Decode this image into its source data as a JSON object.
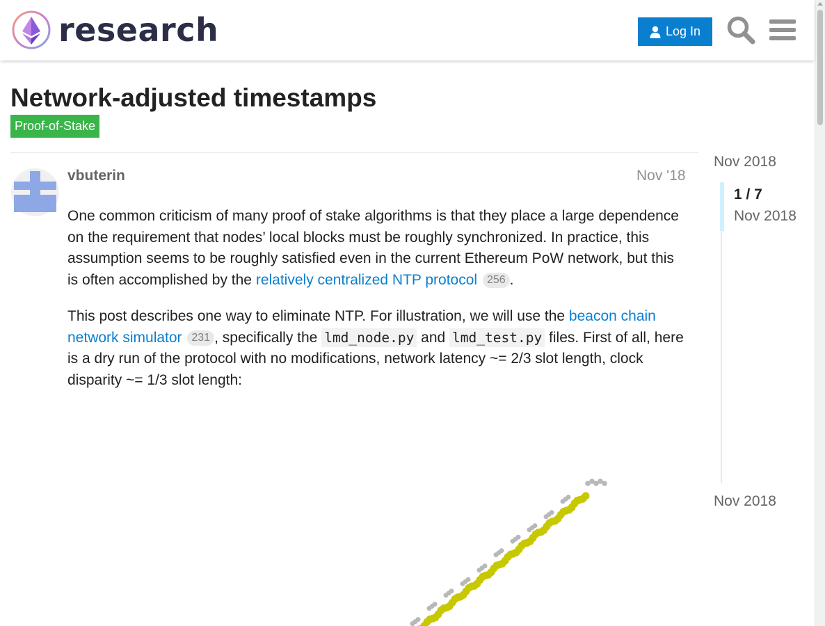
{
  "site": {
    "brand": "research"
  },
  "header": {
    "login_label": "Log In"
  },
  "topic": {
    "title": "Network-adjusted timestamps",
    "category": "Proof-of-Stake",
    "category_color": "#3ab54a"
  },
  "post": {
    "username": "vbuterin",
    "date": "Nov '18",
    "p1_text": "One common criticism of many proof of stake algorithms is that they place a large dependence on the requirement that nodes’ local blocks must be roughly synchronized. In practice, this assumption seems to be roughly satisfied even in the current Ethereum PoW network, but this is often accomplished by the ",
    "p1_link": "relatively centralized NTP protocol",
    "p1_link_count": "256",
    "p1_end": ".",
    "p2_text_a": "This post describes one way to eliminate NTP. For illustration, we will use the ",
    "p2_link": "beacon chain network simulator",
    "p2_link_count": "231",
    "p2_text_b": ", specifically the ",
    "p2_code1": "lmd_node.py",
    "p2_text_c": " and ",
    "p2_code2": "lmd_test.py",
    "p2_text_d": " files. First of all, here is a dry run of the protocol with no modifications, network latency ~= 2/3 slot length, clock disparity ~= 1/3 slot length:"
  },
  "timeline": {
    "start": "Nov 2018",
    "position": "1 / 7",
    "current_date": "Nov 2018",
    "end": "Nov 2018"
  },
  "colors": {
    "link": "#0a7fcf",
    "accent": "#0a7fcf",
    "plot_main": "#c8c800",
    "plot_side": "#b8b8b8"
  },
  "icons": [
    "ethereum-logo-icon",
    "user-icon",
    "search-icon",
    "hamburger-menu-icon",
    "avatar-cross-icon"
  ]
}
